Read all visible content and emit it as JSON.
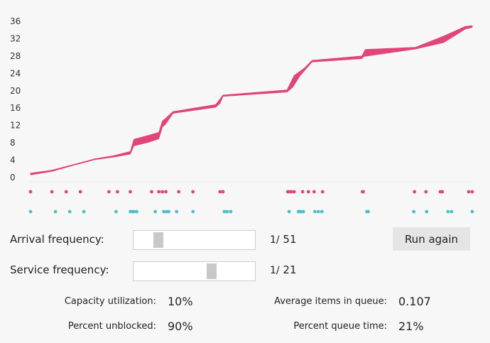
{
  "chart_data": {
    "type": "area",
    "ylim": [
      0,
      36
    ],
    "y_ticks": [
      "0",
      "4",
      "8",
      "12",
      "16",
      "20",
      "24",
      "28",
      "32",
      "36"
    ],
    "x_range": [
      0,
      620
    ],
    "band_color": "#e0457b",
    "arrival_color": "#e0457b",
    "service_color": "#4bc0c8",
    "upper": [
      [
        0,
        1
      ],
      [
        30,
        1.7
      ],
      [
        60,
        3
      ],
      [
        90,
        4.3
      ],
      [
        116,
        5
      ],
      [
        140,
        6
      ],
      [
        145,
        8.8
      ],
      [
        165,
        9.7
      ],
      [
        180,
        10.4
      ],
      [
        185,
        13
      ],
      [
        190,
        13.7
      ],
      [
        200,
        15.2
      ],
      [
        260,
        16.8
      ],
      [
        270,
        19
      ],
      [
        360,
        20.2
      ],
      [
        370,
        23.5
      ],
      [
        385,
        25.3
      ],
      [
        395,
        27
      ],
      [
        465,
        28
      ],
      [
        470,
        29.5
      ],
      [
        540,
        30
      ],
      [
        580,
        32.6
      ],
      [
        610,
        34.8
      ],
      [
        620,
        35
      ]
    ],
    "lower": [
      [
        0,
        0.6
      ],
      [
        30,
        1.4
      ],
      [
        60,
        2.8
      ],
      [
        90,
        4.1
      ],
      [
        116,
        4.7
      ],
      [
        140,
        5.4
      ],
      [
        145,
        7.3
      ],
      [
        165,
        8.1
      ],
      [
        180,
        8.9
      ],
      [
        185,
        11.6
      ],
      [
        190,
        12.4
      ],
      [
        200,
        14.8
      ],
      [
        260,
        16.2
      ],
      [
        266,
        17.1
      ],
      [
        270,
        18.7
      ],
      [
        360,
        19.7
      ],
      [
        368,
        20.8
      ],
      [
        378,
        23.4
      ],
      [
        395,
        26.6
      ],
      [
        465,
        27.4
      ],
      [
        468,
        27.9
      ],
      [
        540,
        29.6
      ],
      [
        580,
        31.1
      ],
      [
        610,
        34.2
      ],
      [
        620,
        34.6
      ]
    ],
    "arrivals_x": [
      0,
      30,
      50,
      70,
      110,
      122,
      140,
      170,
      180,
      185,
      190,
      208,
      228,
      266,
      270,
      361,
      363,
      366,
      370,
      382,
      390,
      398,
      410,
      466,
      467,
      539,
      555,
      575,
      578,
      615,
      620
    ],
    "services_x": [
      0,
      35,
      55,
      75,
      120,
      140,
      143,
      145,
      149,
      175,
      187,
      191,
      194,
      205,
      228,
      272,
      276,
      281,
      363,
      376,
      378,
      380,
      383,
      399,
      404,
      409,
      472,
      474,
      538,
      556,
      586,
      591,
      620
    ]
  },
  "controls": {
    "arrival_label": "Arrival frequency:",
    "arrival_prefix": "1/",
    "arrival_value": "51",
    "arrival_slider_level": 0.17,
    "service_label": "Service frequency:",
    "service_prefix": "1/",
    "service_value": "21",
    "service_slider_level": 0.65,
    "run_button": "Run again"
  },
  "stats": {
    "capacity_label": "Capacity utilization:",
    "capacity_value": "10%",
    "unblocked_label": "Percent unblocked:",
    "unblocked_value": "90%",
    "avg_queue_label": "Average items in queue:",
    "avg_queue_value": "0.107",
    "queue_time_label": "Percent queue time:",
    "queue_time_value": "21%"
  }
}
